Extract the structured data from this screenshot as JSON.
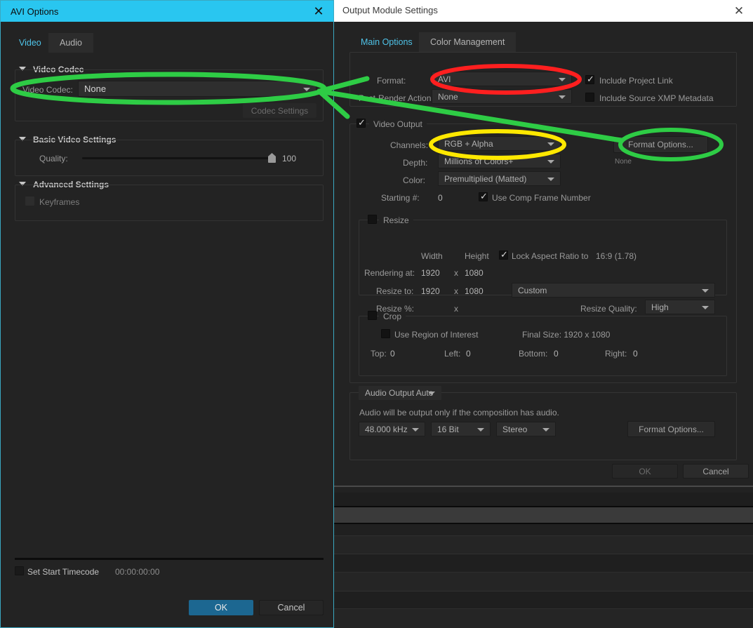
{
  "avi_options": {
    "title": "AVI Options",
    "close_icon": "close-icon",
    "tabs": [
      {
        "label": "Video",
        "active": true
      },
      {
        "label": "Audio",
        "active": false
      }
    ],
    "sections": {
      "video_codec": {
        "title": "Video Codec",
        "codec_label": "Video Codec:",
        "codec_value": "None",
        "codec_settings_button": "Codec Settings"
      },
      "basic_video_settings": {
        "title": "Basic Video Settings",
        "quality_label": "Quality:",
        "quality_value": "100"
      },
      "advanced_settings": {
        "title": "Advanced Settings",
        "keyframes_label": "Keyframes",
        "keyframes_checked": false
      }
    },
    "footer": {
      "set_start_timecode_label": "Set Start Timecode",
      "set_start_timecode_checked": false,
      "timecode_value": "00:00:00:00",
      "ok_label": "OK",
      "cancel_label": "Cancel"
    }
  },
  "output_module_settings": {
    "title": "Output Module Settings",
    "close_icon": "close-icon",
    "tabs": [
      {
        "label": "Main Options",
        "active": true
      },
      {
        "label": "Color Management",
        "active": false
      }
    ],
    "format_panel": {
      "format_label": "Format:",
      "format_value": "AVI",
      "post_render_label": "Post-Render Action:",
      "post_render_value": "None",
      "include_project_link_label": "Include Project Link",
      "include_project_link_checked": true,
      "include_xmp_label": "Include Source XMP Metadata",
      "include_xmp_checked": false
    },
    "video_output": {
      "title": "Video Output",
      "checked": true,
      "channels_label": "Channels:",
      "channels_value": "RGB + Alpha",
      "depth_label": "Depth:",
      "depth_value": "Millions of Colors+",
      "color_label": "Color:",
      "color_value": "Premultiplied (Matted)",
      "starting_label": "Starting #:",
      "starting_value": "0",
      "use_comp_frame_label": "Use Comp Frame Number",
      "use_comp_frame_checked": true,
      "format_options_button": "Format Options...",
      "format_options_status": "None",
      "resize": {
        "title": "Resize",
        "checked": false,
        "width_header": "Width",
        "height_header": "Height",
        "lock_aspect_label": "Lock Aspect Ratio to",
        "lock_aspect_value": "16:9 (1.78)",
        "lock_aspect_checked": true,
        "rendering_at_label": "Rendering at:",
        "rendering_at_width": "1920",
        "rendering_at_x": "x",
        "rendering_at_height": "1080",
        "resize_to_label": "Resize to:",
        "resize_to_width": "1920",
        "resize_to_x": "x",
        "resize_to_height": "1080",
        "preset_value": "Custom",
        "resize_pct_label": "Resize %:",
        "resize_pct_x": "x",
        "resize_quality_label": "Resize Quality:",
        "resize_quality_value": "High"
      },
      "crop": {
        "title": "Crop",
        "checked": false,
        "use_region_label": "Use Region of Interest",
        "use_region_checked": false,
        "final_size_label": "Final Size: 1920 x 1080",
        "top_label": "Top:",
        "top_value": "0",
        "left_label": "Left:",
        "left_value": "0",
        "bottom_label": "Bottom:",
        "bottom_value": "0",
        "right_label": "Right:",
        "right_value": "0"
      }
    },
    "audio_output": {
      "mode_value": "Audio Output Auto",
      "note": "Audio will be output only if the composition has audio.",
      "rate_value": "48.000 kHz",
      "bitdepth_value": "16 Bit",
      "channels_value": "Stereo",
      "format_options_button": "Format Options..."
    },
    "footer": {
      "ok_label": "OK",
      "cancel_label": "Cancel"
    }
  },
  "annotations": {
    "red_color": "#ff1f1f",
    "yellow_color": "#ffe800",
    "green_color": "#2ecc45",
    "items": [
      {
        "name": "red-ellipse-format",
        "color": "#ff1f1f"
      },
      {
        "name": "yellow-ellipse-channels",
        "color": "#ffe800"
      },
      {
        "name": "green-ellipse-video-codec",
        "color": "#2ecc45"
      },
      {
        "name": "green-ellipse-format-options",
        "color": "#2ecc45"
      },
      {
        "name": "green-arrow",
        "color": "#2ecc45"
      }
    ]
  }
}
